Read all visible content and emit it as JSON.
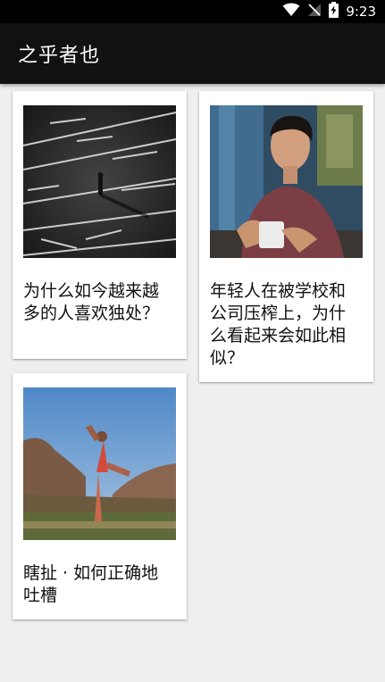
{
  "status_bar": {
    "time": "9:23",
    "icons": [
      "wifi-icon",
      "no-signal-icon",
      "battery-charging-icon"
    ]
  },
  "app_bar": {
    "title": "之乎者也"
  },
  "cards": [
    {
      "title": "为什么如今越来越多的人喜欢独处？",
      "image": "parking-lot-photo"
    },
    {
      "title": "年轻人在被学校和公司压榨上，为什么看起来会如此相似？",
      "image": "man-with-noodles-photo"
    },
    {
      "title": "瞎扯 · 如何正确地吐槽",
      "image": "yoga-desert-photo"
    }
  ]
}
